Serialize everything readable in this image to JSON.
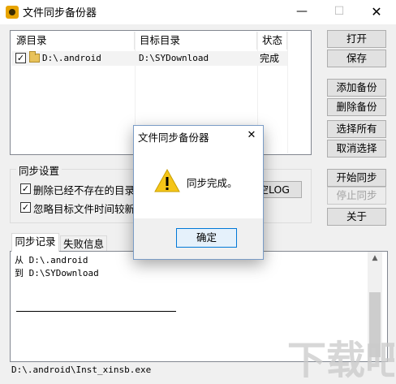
{
  "window": {
    "title": "文件同步备份器",
    "controls": {
      "minimize": "—",
      "maximize": "☐",
      "close": "✕"
    }
  },
  "list": {
    "columns": [
      "源目录",
      "目标目录",
      "状态"
    ],
    "rows": [
      {
        "checked": true,
        "source": "D:\\.android",
        "target": "D:\\SYDownload",
        "status": "完成"
      }
    ]
  },
  "buttons": {
    "open": "打开",
    "save": "保存",
    "add_backup": "添加备份",
    "delete_backup": "删除备份",
    "select_all": "选择所有",
    "deselect_all": "取消选择",
    "start_sync": "开始同步",
    "stop_sync": "停止同步",
    "about": "关于",
    "clear_log": "空LOG"
  },
  "sync_settings": {
    "label": "同步设置",
    "options": [
      {
        "checked": true,
        "label": "删除已经不存在的目录和"
      },
      {
        "checked": true,
        "label": "忽略目标文件时间较新的"
      }
    ]
  },
  "tabs": [
    {
      "label": "同步记录",
      "active": true
    },
    {
      "label": "失败信息",
      "active": false
    }
  ],
  "log_lines": [
    "从 D:\\.android",
    "到 D:\\SYDownload"
  ],
  "status_bar": "D:\\.android\\Inst_xinsb.exe",
  "dialog": {
    "title": "文件同步备份器",
    "message": "同步完成。",
    "ok": "确定",
    "close": "✕",
    "icon": "warning-icon"
  },
  "colors": {
    "dialog_border": "#7a9cc6",
    "ok_border": "#0078d7",
    "warning_yellow": "#f5c518",
    "watermark": "#c9c9c9"
  },
  "watermark": "下载吧"
}
